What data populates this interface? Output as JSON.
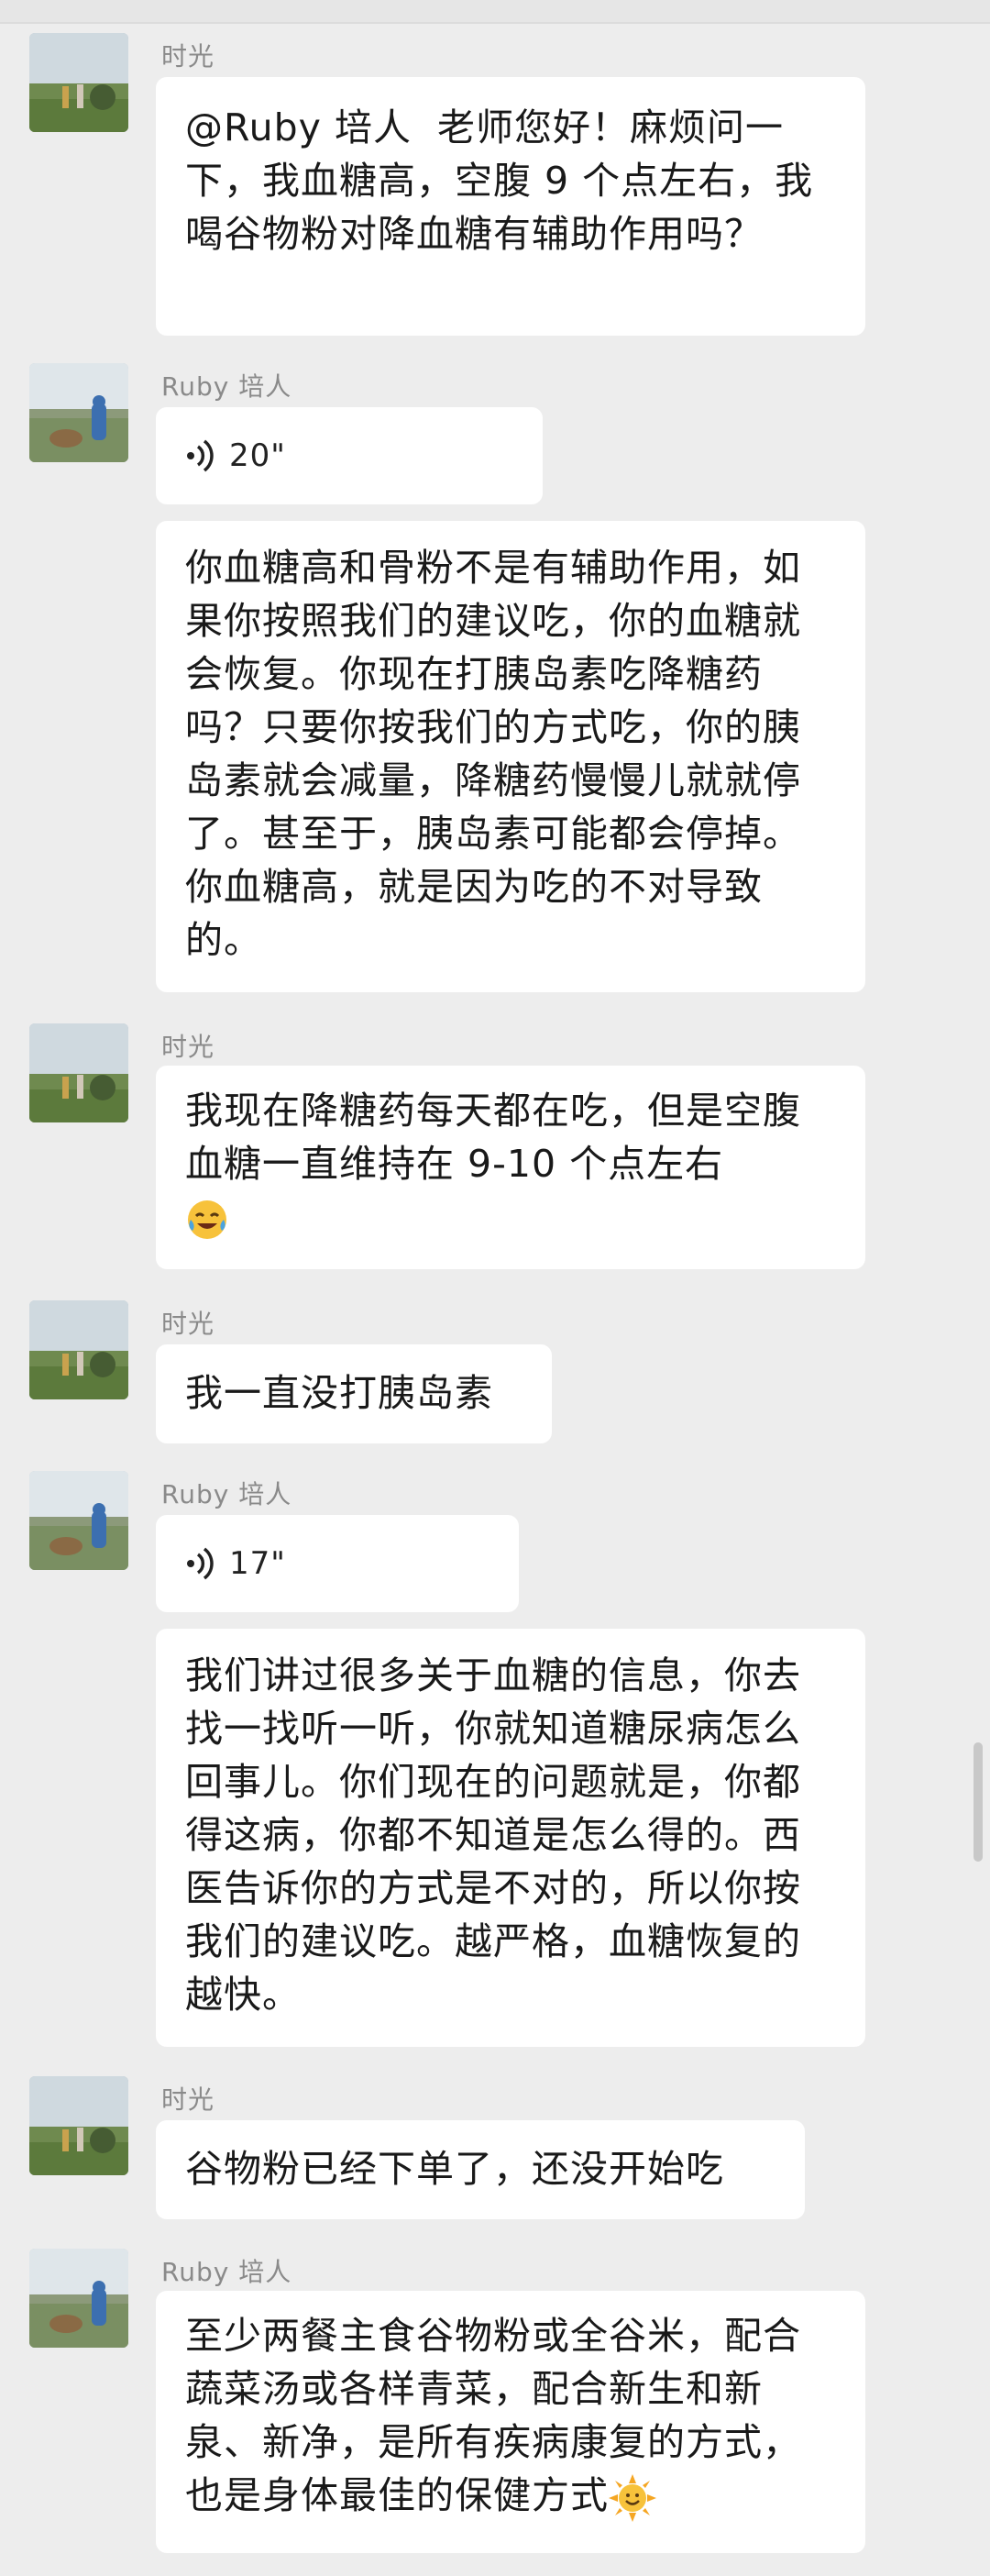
{
  "messages": [
    {
      "sender": "时光",
      "type": "text",
      "text": "@Ruby 培人  老师您好！麻烦问一下，我血糖高，空腹 9 个点左右，我喝谷物粉对降血糖有辅助作用吗？"
    },
    {
      "sender": "Ruby 培人",
      "type": "voice",
      "duration": "20\""
    },
    {
      "sender": "Ruby 培人",
      "type": "text",
      "text": "你血糖高和骨粉不是有辅助作用，如果你按照我们的建议吃，你的血糖就会恢复。你现在打胰岛素吃降糖药吗？只要你按我们的方式吃，你的胰岛素就会减量，降糖药慢慢儿就就停了。甚至于，胰岛素可能都会停掉。你血糖高，就是因为吃的不对导致的。"
    },
    {
      "sender": "时光",
      "type": "text",
      "text": "我现在降糖药每天都在吃，但是空腹血糖一直维持在 9-10 个点左右",
      "emoji": "face-with-tears-of-joy"
    },
    {
      "sender": "时光",
      "type": "text",
      "text": "我一直没打胰岛素"
    },
    {
      "sender": "Ruby 培人",
      "type": "voice",
      "duration": "17\""
    },
    {
      "sender": "Ruby 培人",
      "type": "text",
      "text": "我们讲过很多关于血糖的信息，你去找一找听一听，你就知道糖尿病怎么回事儿。你们现在的问题就是，你都得这病，你都不知道是怎么得的。西医告诉你的方式是不对的，所以你按我们的建议吃。越严格，血糖恢复的越快。"
    },
    {
      "sender": "时光",
      "type": "text",
      "text": "谷物粉已经下单了，还没开始吃"
    },
    {
      "sender": "Ruby 培人",
      "type": "text",
      "text": "至少两餐主食谷物粉或全谷米，配合蔬菜汤或各样青菜，配合新生和新泉、新净，是所有疾病康复的方式，也是身体最佳的保健方式",
      "emoji": "sun-with-face"
    }
  ],
  "colors": {
    "background": "#ededed",
    "bubble": "#ffffff",
    "name": "#8a8a8a",
    "text": "#191919"
  }
}
